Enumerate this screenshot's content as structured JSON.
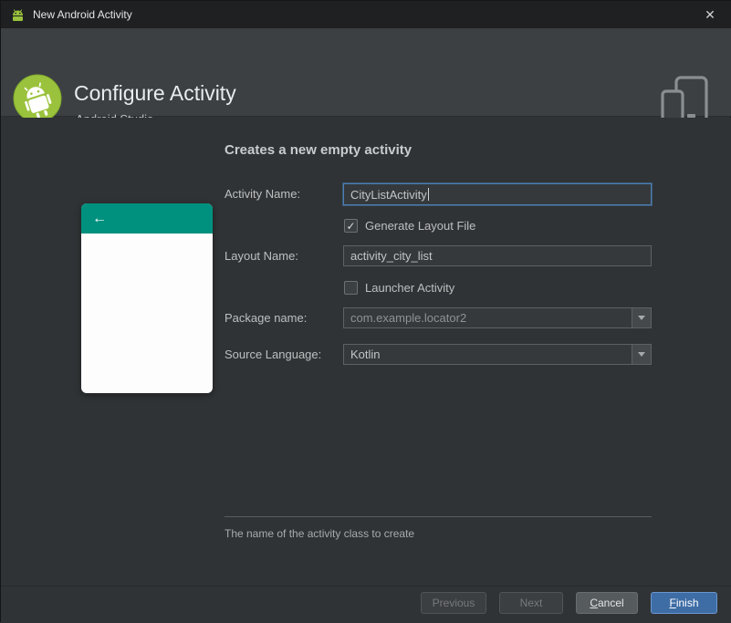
{
  "window": {
    "title": "New Android Activity",
    "close_glyph": "✕"
  },
  "header": {
    "title": "Configure Activity",
    "subtitle": "Android Studio"
  },
  "main": {
    "heading": "Creates a new empty activity",
    "preview": {
      "back_glyph": "←"
    },
    "form": {
      "activity_name": {
        "label": "Activity Name:",
        "value": "CityListActivity"
      },
      "generate_layout": {
        "label": "Generate Layout File",
        "checked": true
      },
      "layout_name": {
        "label": "Layout Name:",
        "value": "activity_city_list"
      },
      "launcher_activity": {
        "label": "Launcher Activity",
        "checked": false
      },
      "package_name": {
        "label": "Package name:",
        "value": "com.example.locator2"
      },
      "source_language": {
        "label": "Source Language:",
        "value": "Kotlin"
      }
    },
    "hint": "The name of the activity class to create"
  },
  "footer": {
    "previous": {
      "label": "Previous",
      "enabled": false
    },
    "next": {
      "label": "Next",
      "enabled": false
    },
    "cancel": {
      "label": "Cancel",
      "enabled": true
    },
    "finish": {
      "label": "Finish",
      "enabled": true
    }
  },
  "colors": {
    "accent_focus": "#4e7fb2",
    "primary_button": "#3e6da6",
    "preview_teal": "#00917e",
    "android_green": "#9ac23c"
  }
}
